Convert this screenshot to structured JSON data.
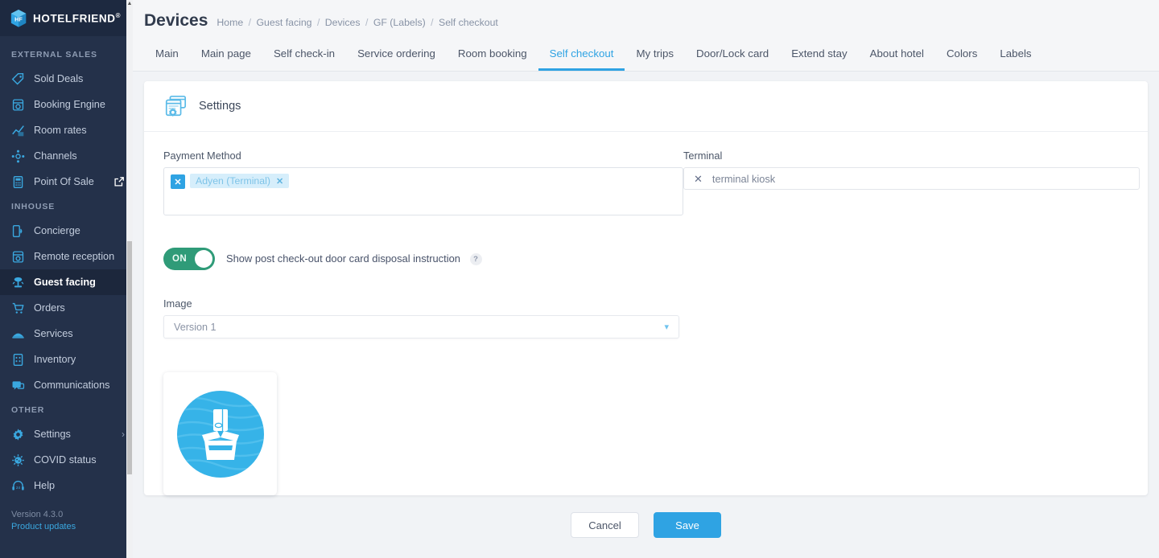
{
  "sidebar": {
    "brand": "HOTELFRIEND",
    "brand_reg": "®",
    "collapse_icon": "chevron-left-icon",
    "sections": [
      {
        "label": "EXTERNAL SALES",
        "items": [
          {
            "label": "Sold Deals",
            "icon": "tag-icon",
            "active": false
          },
          {
            "label": "Booking Engine",
            "icon": "booking-icon",
            "active": false
          },
          {
            "label": "Room rates",
            "icon": "chart-icon",
            "active": false
          },
          {
            "label": "Channels",
            "icon": "channels-icon",
            "active": false
          },
          {
            "label": "Point Of Sale",
            "icon": "pos-icon",
            "active": false,
            "trailing": "external-link-icon"
          }
        ]
      },
      {
        "label": "INHOUSE",
        "items": [
          {
            "label": "Concierge",
            "icon": "concierge-icon",
            "active": false
          },
          {
            "label": "Remote reception",
            "icon": "reception-icon",
            "active": false
          },
          {
            "label": "Guest facing",
            "icon": "guest-facing-icon",
            "active": true
          },
          {
            "label": "Orders",
            "icon": "cart-icon",
            "active": false
          },
          {
            "label": "Services",
            "icon": "services-icon",
            "active": false
          },
          {
            "label": "Inventory",
            "icon": "inventory-icon",
            "active": false
          },
          {
            "label": "Communications",
            "icon": "communications-icon",
            "active": false
          }
        ]
      },
      {
        "label": "OTHER",
        "items": [
          {
            "label": "Settings",
            "icon": "gear-icon",
            "active": false,
            "trailing": "chevron-right-icon"
          },
          {
            "label": "COVID status",
            "icon": "virus-icon",
            "active": false
          },
          {
            "label": "Help",
            "icon": "headset-icon",
            "active": false
          }
        ]
      }
    ],
    "version": "Version 4.3.0",
    "product_updates": "Product updates"
  },
  "header": {
    "title": "Devices",
    "breadcrumbs": [
      "Home",
      "Guest facing",
      "Devices",
      "GF (Labels)",
      "Self checkout"
    ],
    "separator": "/"
  },
  "tabs": [
    {
      "label": "Main",
      "active": false
    },
    {
      "label": "Main page",
      "active": false
    },
    {
      "label": "Self check-in",
      "active": false
    },
    {
      "label": "Service ordering",
      "active": false
    },
    {
      "label": "Room booking",
      "active": false
    },
    {
      "label": "Self checkout",
      "active": true
    },
    {
      "label": "My trips",
      "active": false
    },
    {
      "label": "Door/Lock card",
      "active": false
    },
    {
      "label": "Extend stay",
      "active": false
    },
    {
      "label": "About hotel",
      "active": false
    },
    {
      "label": "Colors",
      "active": false
    },
    {
      "label": "Labels",
      "active": false
    }
  ],
  "card": {
    "icon": "settings-windows-icon",
    "title": "Settings",
    "payment_method": {
      "label": "Payment Method",
      "clear_all_icon": "x-icon",
      "chips": [
        {
          "label": "Adyen (Terminal)",
          "remove_icon": "x-icon"
        }
      ]
    },
    "terminal": {
      "label": "Terminal",
      "clear_icon": "x-icon",
      "value": "terminal kiosk"
    },
    "toggle": {
      "state_text": "ON",
      "enabled": true,
      "label": "Show post check-out door card disposal instruction",
      "help_icon": "question-mark-icon"
    },
    "image": {
      "label": "Image",
      "selected_version": "Version 1",
      "chevron_icon": "chevron-down-icon",
      "preview_icon": "card-into-box-icon"
    }
  },
  "footer": {
    "cancel_label": "Cancel",
    "save_label": "Save"
  },
  "colors": {
    "accent": "#2fa3e3",
    "sidebar_bg": "#24314a",
    "sidebar_brand_bg": "#1d2940",
    "toggle_on": "#2f9b78",
    "page_bg": "#f1f3f6",
    "chip_bg": "#d6eefb"
  }
}
